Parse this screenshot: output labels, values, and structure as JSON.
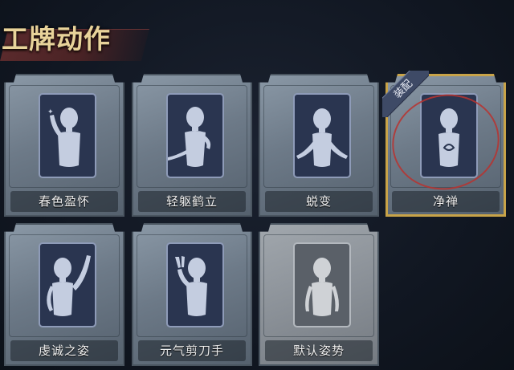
{
  "title": "工牌动作",
  "equipped_badge": "装配",
  "cards": [
    {
      "label": "春色盈怀",
      "equipped": false,
      "pose": "fairy-hand"
    },
    {
      "label": "轻躯鹤立",
      "equipped": false,
      "pose": "graceful"
    },
    {
      "label": "蜕变",
      "equipped": false,
      "pose": "open-arms"
    },
    {
      "label": "净禅",
      "equipped": true,
      "pose": "prayer"
    },
    {
      "label": "虔诚之姿",
      "equipped": false,
      "pose": "raised-hand"
    },
    {
      "label": "元气剪刀手",
      "equipped": false,
      "pose": "peace-sign"
    },
    {
      "label": "默认姿势",
      "equipped": false,
      "pose": "default"
    }
  ],
  "colors": {
    "title": "#e8d39a",
    "equipped_border": "#c8a348",
    "annotation_circle": "#b8322f"
  }
}
